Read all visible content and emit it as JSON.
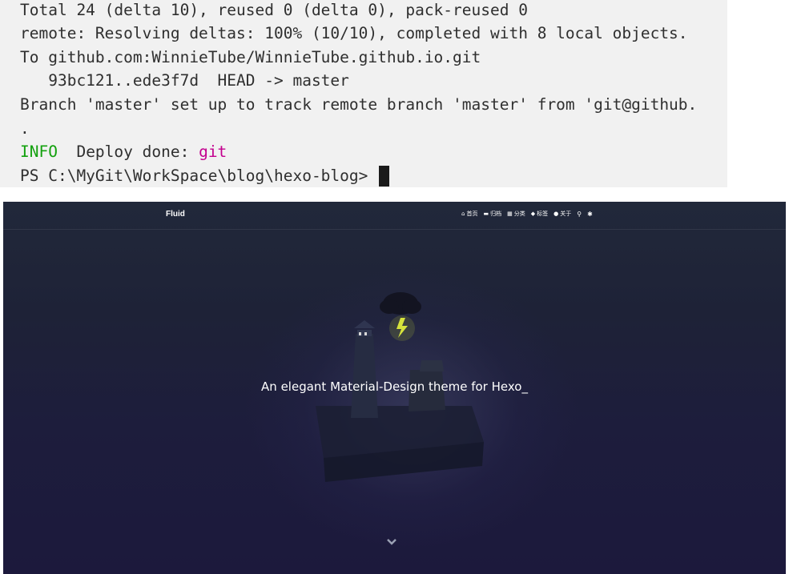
{
  "terminal": {
    "lines": [
      "Total 24 (delta 10), reused 0 (delta 0), pack-reused 0",
      "remote: Resolving deltas: 100% (10/10), completed with 8 local objects.",
      "To github.com:WinnieTube/WinnieTube.github.io.git",
      "   93bc121..ede3f7d  HEAD -> master",
      "Branch 'master' set up to track remote branch 'master' from 'git@github.",
      "."
    ],
    "info_tag": "INFO",
    "info_text": "  Deploy done: ",
    "info_highlight": "git",
    "prompt": "PS C:\\MyGit\\WorkSpace\\blog\\hexo-blog> ",
    "colors": {
      "info": "#13a10e",
      "highlight": "#c3008e"
    }
  },
  "site": {
    "brand": "Fluid",
    "nav": [
      {
        "icon": "home-icon",
        "label": "首页"
      },
      {
        "icon": "archive-icon",
        "label": "归档"
      },
      {
        "icon": "grid-icon",
        "label": "分类"
      },
      {
        "icon": "tag-icon",
        "label": "标签"
      },
      {
        "icon": "user-icon",
        "label": "关于"
      }
    ],
    "actions": [
      "search-icon",
      "theme-toggle-icon"
    ],
    "subtitle": "An elegant Material-Design theme for Hexo",
    "cursor": "_",
    "scroll_icon": "chevron-down-icon"
  }
}
